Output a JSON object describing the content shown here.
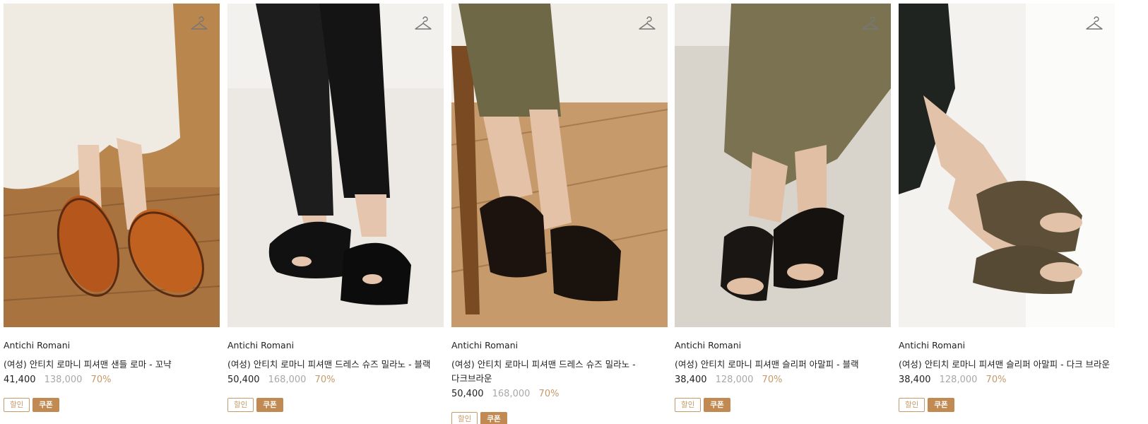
{
  "products": [
    {
      "brand": "Antichi Romani",
      "title": "(여성) 안티치 로마니 피셔맨 샌들 로마 - 꼬냑",
      "sale_price": "41,400",
      "original_price": "138,000",
      "discount_rate": "70%",
      "badges": {
        "sale": "할인",
        "coupon": "쿠폰"
      }
    },
    {
      "brand": "Antichi Romani",
      "title": "(여성) 안티치 로마니 피셔맨 드레스 슈즈 밀라노 - 블랙",
      "sale_price": "50,400",
      "original_price": "168,000",
      "discount_rate": "70%",
      "badges": {
        "sale": "할인",
        "coupon": "쿠폰"
      }
    },
    {
      "brand": "Antichi Romani",
      "title": "(여성) 안티치 로마니 피셔맨 드레스 슈즈 밀라노 - 다크브라운",
      "sale_price": "50,400",
      "original_price": "168,000",
      "discount_rate": "70%",
      "badges": {
        "sale": "할인",
        "coupon": "쿠폰"
      }
    },
    {
      "brand": "Antichi Romani",
      "title": "(여성) 안티치 로마니 피셔맨 슬리퍼 아말피 - 블랙",
      "sale_price": "38,400",
      "original_price": "128,000",
      "discount_rate": "70%",
      "badges": {
        "sale": "할인",
        "coupon": "쿠폰"
      }
    },
    {
      "brand": "Antichi Romani",
      "title": "(여성) 안티치 로마니 피셔맨 슬리퍼 아말피 - 다크 브라운",
      "sale_price": "38,400",
      "original_price": "128,000",
      "discount_rate": "70%",
      "badges": {
        "sale": "할인",
        "coupon": "쿠폰"
      }
    }
  ],
  "icons": {
    "wishlist": "hanger-icon"
  },
  "colors": {
    "accent": "#c59a6a",
    "coupon_bg": "#c08a52",
    "muted_price": "#a8a8a8"
  }
}
